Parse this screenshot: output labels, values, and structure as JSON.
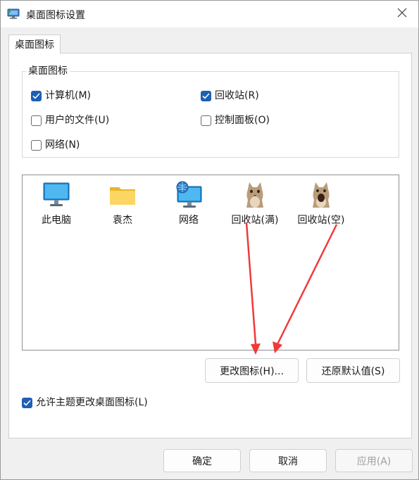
{
  "window": {
    "title": "桌面图标设置"
  },
  "tab": {
    "label": "桌面图标"
  },
  "group": {
    "label": "桌面图标",
    "checkboxes": [
      {
        "label": "计算机(M)",
        "checked": true
      },
      {
        "label": "回收站(R)",
        "checked": true
      },
      {
        "label": "用户的文件(U)",
        "checked": false
      },
      {
        "label": "控制面板(O)",
        "checked": false
      },
      {
        "label": "网络(N)",
        "checked": false
      }
    ]
  },
  "icons": [
    {
      "label": "此电脑",
      "icon": "monitor-icon"
    },
    {
      "label": "袁杰",
      "icon": "folder-icon"
    },
    {
      "label": "网络",
      "icon": "network-icon"
    },
    {
      "label": "回收站(满)",
      "icon": "cat-icon"
    },
    {
      "label": "回收站(空)",
      "icon": "cat-icon"
    }
  ],
  "buttons": {
    "change_icon": "更改图标(H)...",
    "restore_default": "还原默认值(S)",
    "ok": "确定",
    "cancel": "取消",
    "apply": "应用(A)"
  },
  "allow_themes": {
    "label": "允许主题更改桌面图标(L)",
    "checked": true
  },
  "colors": {
    "accent": "#1d5fb3",
    "annotation_arrow": "#f03a3a"
  }
}
